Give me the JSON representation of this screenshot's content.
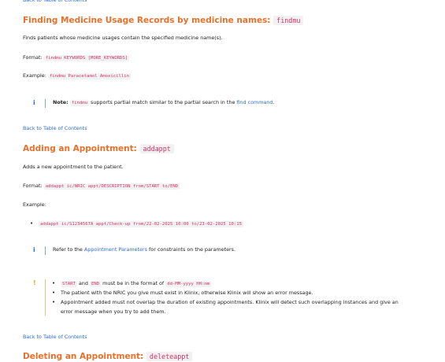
{
  "nav": {
    "back_to_toc": "Back to Table of Contents"
  },
  "findmu": {
    "title": "Finding Medicine Usage Records by medicine names:",
    "command": "findmu",
    "description": "Finds patients whose medicine usages contain the specified medicine name(s).",
    "format_label": "Format:",
    "format_value": "findmu KEYWORDS [MORE_KEYWORDS]",
    "example_label": "Example:",
    "example_value": "findmu Paracetamol Amoxicillin",
    "note_icon": "info-icon",
    "note_label": "Note:",
    "note_code": "findmu",
    "note_text": "supports partial match similar to the partial search in the",
    "note_link": "find command",
    "note_end": "."
  },
  "addappt": {
    "title": "Adding an Appointment:",
    "command": "addappt",
    "description": "Adds a new appointment to the patient.",
    "format_label": "Format:",
    "format_value": "addappt ic/NRIC appt/DESCRIPTION from/START to/END",
    "example_label": "Example:",
    "example_value": "addappt ic/S1234567A appt/Check-up from/22-02-2025 10:00 to/23-02-2025 10:15",
    "info_icon": "info-icon",
    "info_text_before": "Refer to the",
    "info_link": "Appointment Parameters",
    "info_text_after": "for constraints on the parameters.",
    "warn_icon": "warning-icon",
    "warn_item1_code_a": "START",
    "warn_item1_and": "and",
    "warn_item1_code_b": "END",
    "warn_item1_text": "must be in the format of",
    "warn_item1_code_c": "dd-MM-yyyy HH:mm",
    "warn_item2": "The patient with the NRIC you give must exist in Klinix, otherwise Klinix will show an error message.",
    "warn_item3_line1": "Appointment added must not overlap the duration of existing appointments. Klinix will detect such overlapping instances and give an",
    "warn_item3_line2": "error message when you try to add them."
  },
  "deleteappt": {
    "title": "Deleting an Appointment:",
    "command": "deleteappt"
  }
}
